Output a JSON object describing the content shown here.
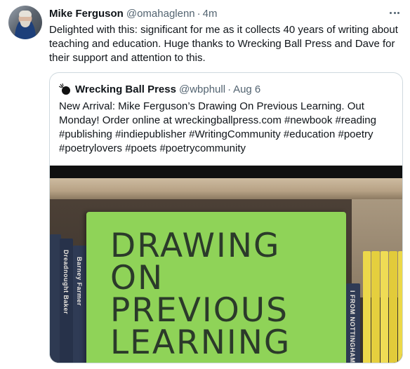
{
  "tweet": {
    "author_name": "Mike Ferguson",
    "author_handle": "@omahaglenn",
    "separator": "·",
    "timestamp": "4m",
    "more_label": "···",
    "text": "Delighted with this: significant for me as it collects 40 years of writing about teaching and education. Huge thanks to Wrecking Ball Press and Dave for their support and attention to this."
  },
  "quote": {
    "author_name": "Wrecking Ball Press",
    "author_handle": "@wbphull",
    "separator": "·",
    "timestamp": "Aug 6",
    "text_intro": "New Arrival: Mike Ferguson’s Drawing On Previous Learning. Out Monday! Order online at wreckingballpress.com",
    "hashtags": [
      "#newbook",
      "#reading",
      "#publishing",
      "#indiepublisher",
      "#WritingCommunity",
      "#education",
      "#poetry",
      "#poetrylovers",
      "#poets",
      "#poetrycommunity"
    ],
    "image": {
      "book_title_lines": [
        "DRAWING",
        "ON",
        "PREVIOUS",
        "LEARNING"
      ],
      "spine_labels": [
        "Dreadnought Baker",
        "Barney Farmer",
        "Dreadnought Baker",
        "Barney Farmer",
        "I FROM NOTTINGHAM"
      ],
      "colors": {
        "cover": "#8fd358",
        "title": "#2b3a2a",
        "spines": "#2e3a52",
        "yellow": "#ecd84a"
      }
    }
  }
}
